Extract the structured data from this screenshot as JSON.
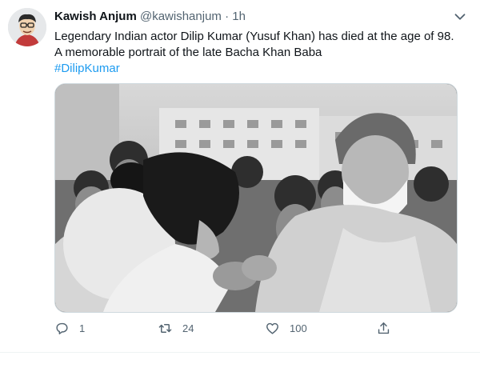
{
  "tweet": {
    "author": {
      "display_name": "Kawish Anjum",
      "handle": "@kawishanjum",
      "separator": "·",
      "time": "1h"
    },
    "text_lines": [
      "Legendary Indian actor Dilip Kumar (Yusuf Khan) has died at the age of 98.",
      "A memorable portrait of the late Bacha Khan Baba"
    ],
    "hashtag": "#DilipKumar",
    "actions": {
      "reply_count": "1",
      "retweet_count": "24",
      "like_count": "100"
    }
  },
  "colors": {
    "link_blue": "#1d9bf0",
    "muted": "#536471",
    "border": "#cfd9de"
  }
}
